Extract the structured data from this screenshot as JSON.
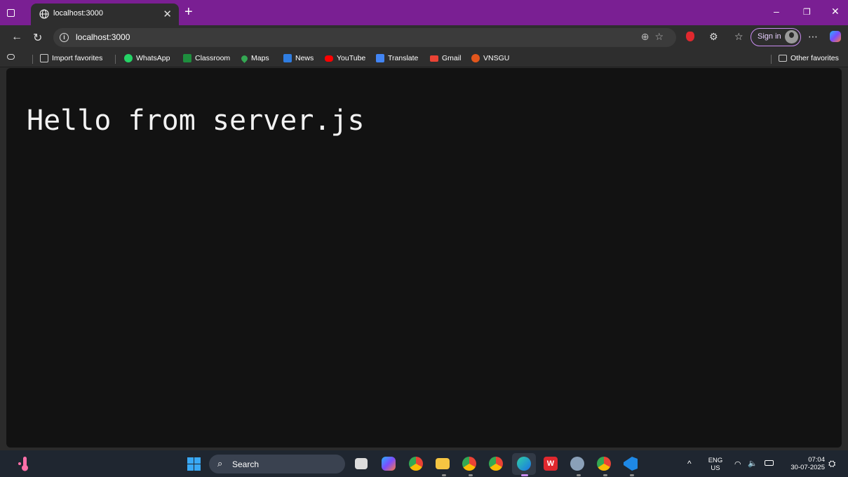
{
  "browser": {
    "tab_title": "localhost:3000",
    "url": "localhost:3000",
    "signin_label": "Sign in"
  },
  "favorites": {
    "items": [
      {
        "label": "Import favorites",
        "icon": "import-icon",
        "color": "#cccccc"
      },
      {
        "label": "WhatsApp",
        "icon": "whatsapp-icon",
        "color": "#25d366"
      },
      {
        "label": "Classroom",
        "icon": "classroom-icon",
        "color": "#1e8e3e"
      },
      {
        "label": "Maps",
        "icon": "maps-icon",
        "color": "#34a853"
      },
      {
        "label": "News",
        "icon": "news-icon",
        "color": "#2f7de1"
      },
      {
        "label": "YouTube",
        "icon": "youtube-icon",
        "color": "#ff0000"
      },
      {
        "label": "Translate",
        "icon": "translate-icon",
        "color": "#4285f4"
      },
      {
        "label": "Gmail",
        "icon": "gmail-icon",
        "color": "#ea4335"
      },
      {
        "label": "VNSGU",
        "icon": "vnsgu-icon",
        "color": "#e2561c"
      }
    ],
    "other_label": "Other favorites"
  },
  "page": {
    "heading": "Hello from server.js"
  },
  "taskbar": {
    "search_label": "Search",
    "lang": "ENG",
    "region": "US",
    "time": "07:04",
    "date": "30-07-2025"
  }
}
